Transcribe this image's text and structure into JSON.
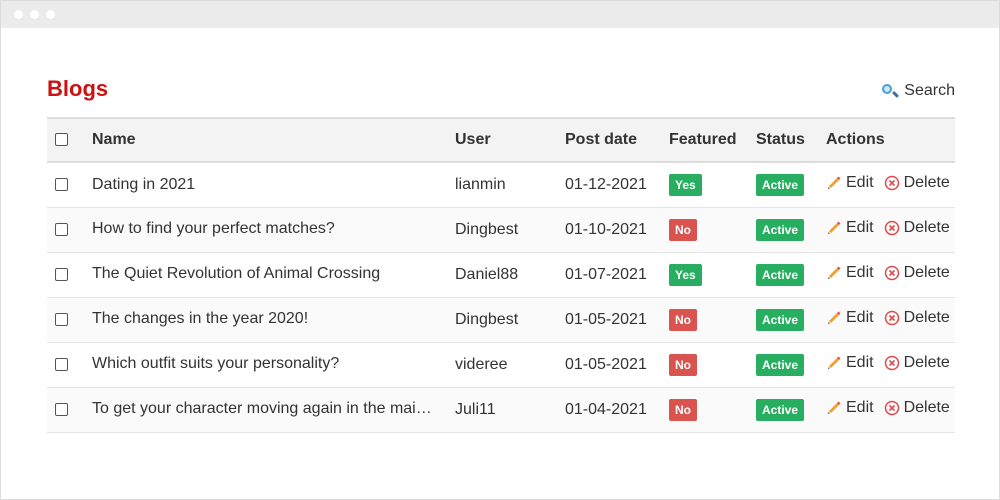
{
  "table": {
    "title": "Blogs",
    "search_label": "Search",
    "headers": {
      "name": "Name",
      "user": "User",
      "post_date": "Post date",
      "featured": "Featured",
      "status": "Status",
      "actions": "Actions"
    },
    "rows": [
      {
        "name": "Dating in 2021",
        "user": "lianmin",
        "date": "01-12-2021",
        "featured": "Yes",
        "status": "Active"
      },
      {
        "name": "How to find your perfect matches?",
        "user": "Dingbest",
        "date": "01-10-2021",
        "featured": "No",
        "status": "Active"
      },
      {
        "name": "The Quiet Revolution of Animal Crossing",
        "user": "Daniel88",
        "date": "01-07-2021",
        "featured": "Yes",
        "status": "Active"
      },
      {
        "name": "The changes in the year 2020!",
        "user": "Dingbest",
        "date": "01-05-2021",
        "featured": "No",
        "status": "Active"
      },
      {
        "name": "Which outfit suits your personality?",
        "user": "videree",
        "date": "01-05-2021",
        "featured": "No",
        "status": "Active"
      },
      {
        "name": "To get your character moving again in the mai…",
        "user": "Juli11",
        "date": "01-04-2021",
        "featured": "No",
        "status": "Active"
      }
    ],
    "edit_label": "Edit",
    "delete_label": "Delete"
  },
  "icons": {
    "search": "search-icon",
    "edit": "pencil-icon",
    "delete": "delete-icon"
  },
  "colors": {
    "title": "#cc1111",
    "badge_yes": "#27ae60",
    "badge_no": "#d9534f",
    "badge_active": "#27ae60",
    "delete_icon": "#e04a4a"
  }
}
